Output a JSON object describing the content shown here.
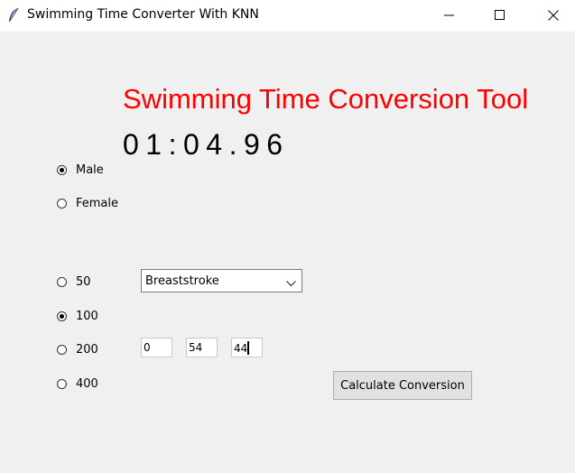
{
  "window": {
    "title": "Swimming Time Converter With KNN",
    "minimize_icon": "minimize-icon",
    "maximize_icon": "maximize-icon",
    "close_icon": "close-icon",
    "app_icon": "feather-icon"
  },
  "main": {
    "heading": "Swimming Time Conversion Tool",
    "heading_color": "#ff0000",
    "result": "01:04.96"
  },
  "gender": {
    "selected": "Male",
    "options": [
      {
        "label": "Male",
        "checked": true
      },
      {
        "label": "Female",
        "checked": false
      }
    ]
  },
  "distance": {
    "selected": "100",
    "options": [
      {
        "label": "50",
        "checked": false
      },
      {
        "label": "100",
        "checked": true
      },
      {
        "label": "200",
        "checked": false
      },
      {
        "label": "400",
        "checked": false
      }
    ]
  },
  "stroke": {
    "selected": "Breaststroke",
    "chevron_icon": "chevron-down-icon"
  },
  "time_inputs": {
    "minutes": "0",
    "seconds": "54",
    "hundredths": "44"
  },
  "actions": {
    "calculate_label": "Calculate Conversion"
  }
}
